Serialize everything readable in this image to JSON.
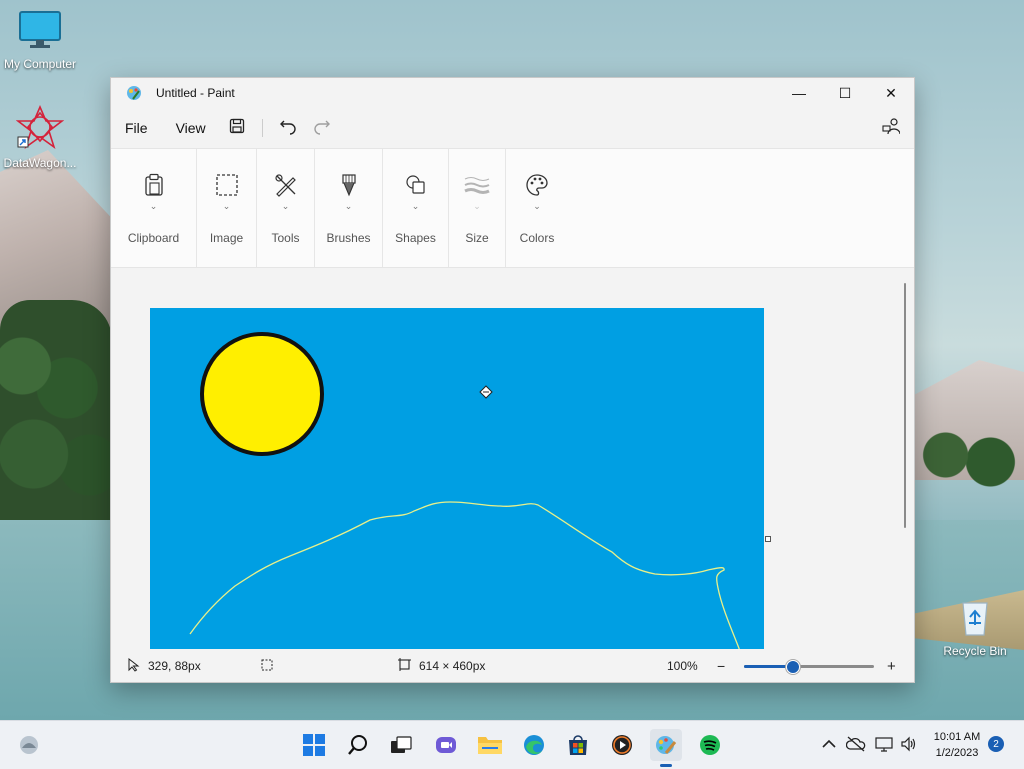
{
  "desktop": {
    "icons": [
      {
        "label": "My Computer"
      },
      {
        "label": "DataWagon..."
      },
      {
        "label": "Recycle Bin"
      }
    ]
  },
  "window": {
    "title": "Untitled - Paint",
    "menu": {
      "file": "File",
      "view": "View"
    },
    "ribbon": {
      "groups": [
        {
          "label": "Clipboard",
          "icon": "clipboard-icon"
        },
        {
          "label": "Image",
          "icon": "selection-icon"
        },
        {
          "label": "Tools",
          "icon": "tools-icon"
        },
        {
          "label": "Brushes",
          "icon": "brush-icon"
        },
        {
          "label": "Shapes",
          "icon": "shapes-icon"
        },
        {
          "label": "Size",
          "icon": "size-icon"
        },
        {
          "label": "Colors",
          "icon": "palette-icon"
        }
      ]
    },
    "canvas": {
      "background_color": "#009fe3",
      "sun_fill": "#ffef00",
      "line_color": "#e8f08a"
    },
    "status": {
      "cursor_pos": "329, 88px",
      "canvas_size": "614 × 460px",
      "zoom": "100%",
      "zoom_fraction": 0.37
    }
  },
  "taskbar": {
    "apps": [
      "start-icon",
      "search-icon",
      "task-view-icon",
      "teams-icon",
      "file-explorer-icon",
      "edge-icon",
      "store-icon",
      "media-player-icon",
      "paint-icon",
      "spotify-icon"
    ],
    "time": "10:01 AM",
    "date": "1/2/2023",
    "notifications": "2"
  }
}
